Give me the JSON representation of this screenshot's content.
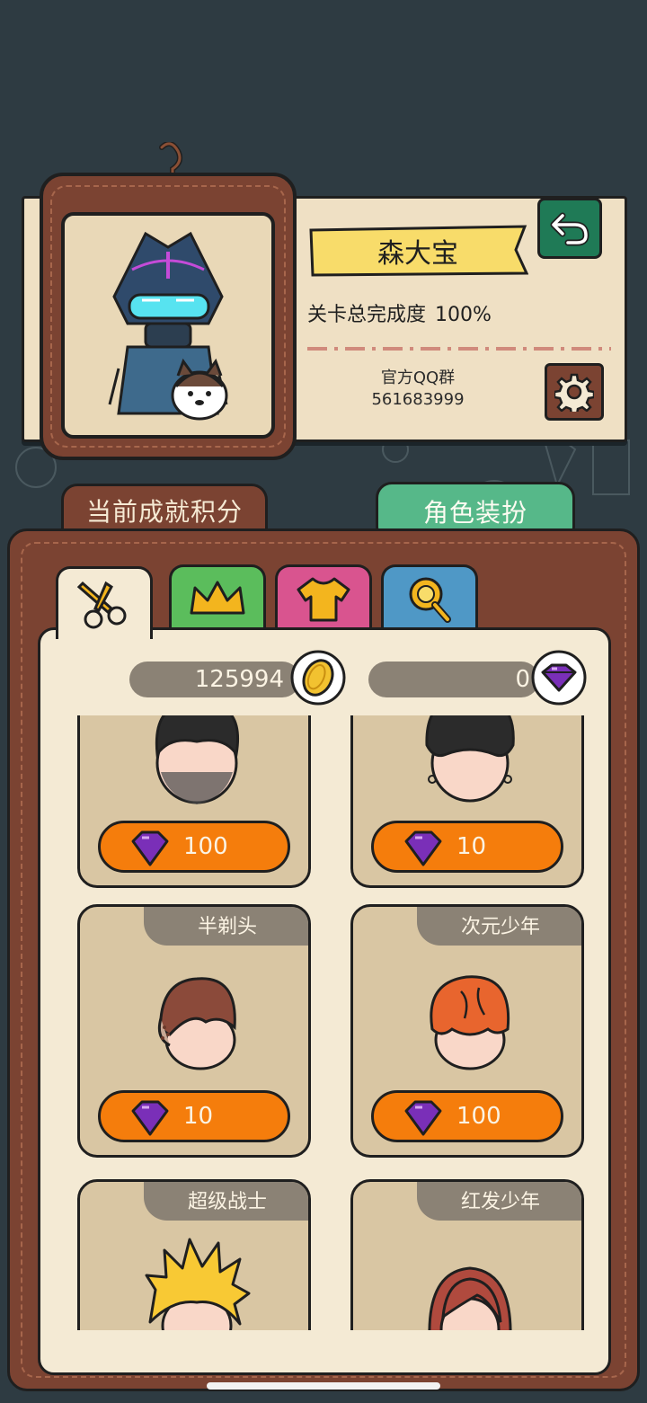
{
  "profile": {
    "player_name": "森大宝",
    "completion_label": "关卡总完成度",
    "completion_value": "100%",
    "qq_group_label": "官方QQ群",
    "qq_group_number": "561683999"
  },
  "section_tabs": {
    "achievement_label": "当前成就积分",
    "dressup_label": "角色装扮"
  },
  "category_tabs": [
    {
      "icon": "scissors-icon",
      "color": "#f4ead4",
      "active": true
    },
    {
      "icon": "crown-icon",
      "color": "#5bbd5c",
      "active": false
    },
    {
      "icon": "shirt-icon",
      "color": "#d9548f",
      "active": false
    },
    {
      "icon": "magnifier-icon",
      "color": "#4f98c6",
      "active": false
    }
  ],
  "currency": {
    "coins": "125994",
    "gems": "0"
  },
  "items": [
    {
      "name": "",
      "price": "100",
      "currency_icon": "gem-icon"
    },
    {
      "name": "",
      "price": "10",
      "currency_icon": "gem-icon"
    },
    {
      "name": "半剃头",
      "price": "10",
      "currency_icon": "gem-icon"
    },
    {
      "name": "次元少年",
      "price": "100",
      "currency_icon": "gem-icon"
    },
    {
      "name": "超级战士",
      "price": "",
      "currency_icon": "gem-icon"
    },
    {
      "name": "红发少年",
      "price": "",
      "currency_icon": "gem-icon"
    }
  ],
  "colors": {
    "background": "#2e3b42",
    "panel_brown": "#7b4332",
    "panel_cream": "#f4ead4",
    "price_orange": "#f57d0c",
    "gem_purple": "#7a2fb8",
    "coin_gold": "#f2c230",
    "back_green": "#1f7a56"
  }
}
